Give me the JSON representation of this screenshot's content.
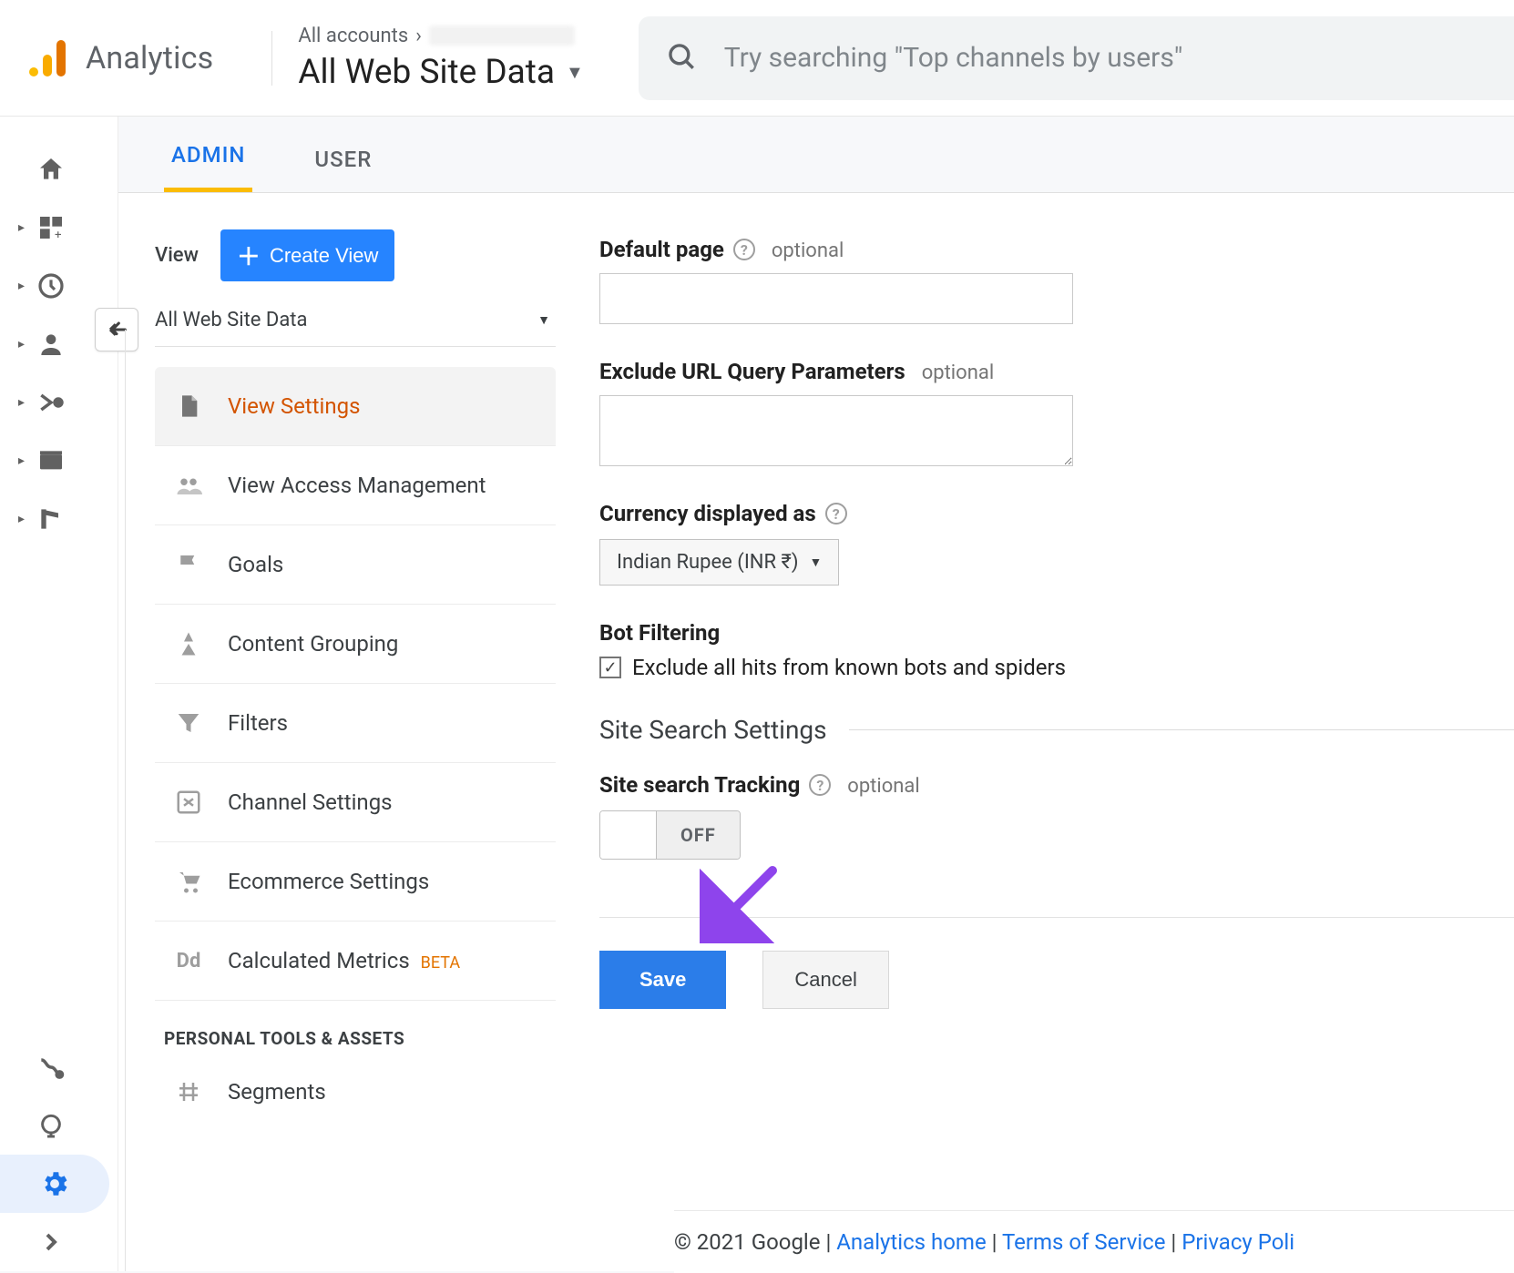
{
  "header": {
    "product": "Analytics",
    "breadcrumb_prefix": "All accounts",
    "breadcrumb_sep": "›",
    "account_title": "All Web Site Data",
    "search_placeholder": "Try searching \"Top channels by users\""
  },
  "tabs": {
    "admin": "ADMIN",
    "user": "USER"
  },
  "view": {
    "label": "View",
    "create": "Create View",
    "selector": "All Web Site Data"
  },
  "menu": {
    "view_settings": "View Settings",
    "view_access": "View Access Management",
    "goals": "Goals",
    "content_grouping": "Content Grouping",
    "filters": "Filters",
    "channel_settings": "Channel Settings",
    "ecommerce": "Ecommerce Settings",
    "calc_metrics": "Calculated Metrics",
    "beta": "BETA",
    "personal_header": "PERSONAL TOOLS & ASSETS",
    "segments": "Segments"
  },
  "settings": {
    "default_page": {
      "label": "Default page",
      "optional": "optional",
      "value": ""
    },
    "exclude_params": {
      "label": "Exclude URL Query Parameters",
      "optional": "optional",
      "value": ""
    },
    "currency": {
      "label": "Currency displayed as",
      "value": "Indian Rupee (INR ₹)"
    },
    "bot": {
      "label": "Bot Filtering",
      "checkbox": "Exclude all hits from known bots and spiders",
      "checked": true
    },
    "section": "Site Search Settings",
    "site_search": {
      "label": "Site search Tracking",
      "optional": "optional",
      "toggle": "OFF"
    },
    "save": "Save",
    "cancel": "Cancel"
  },
  "footer": {
    "copyright": "© 2021 Google",
    "sep": " | ",
    "home": "Analytics home",
    "tos": "Terms of Service",
    "privacy": "Privacy Poli"
  }
}
